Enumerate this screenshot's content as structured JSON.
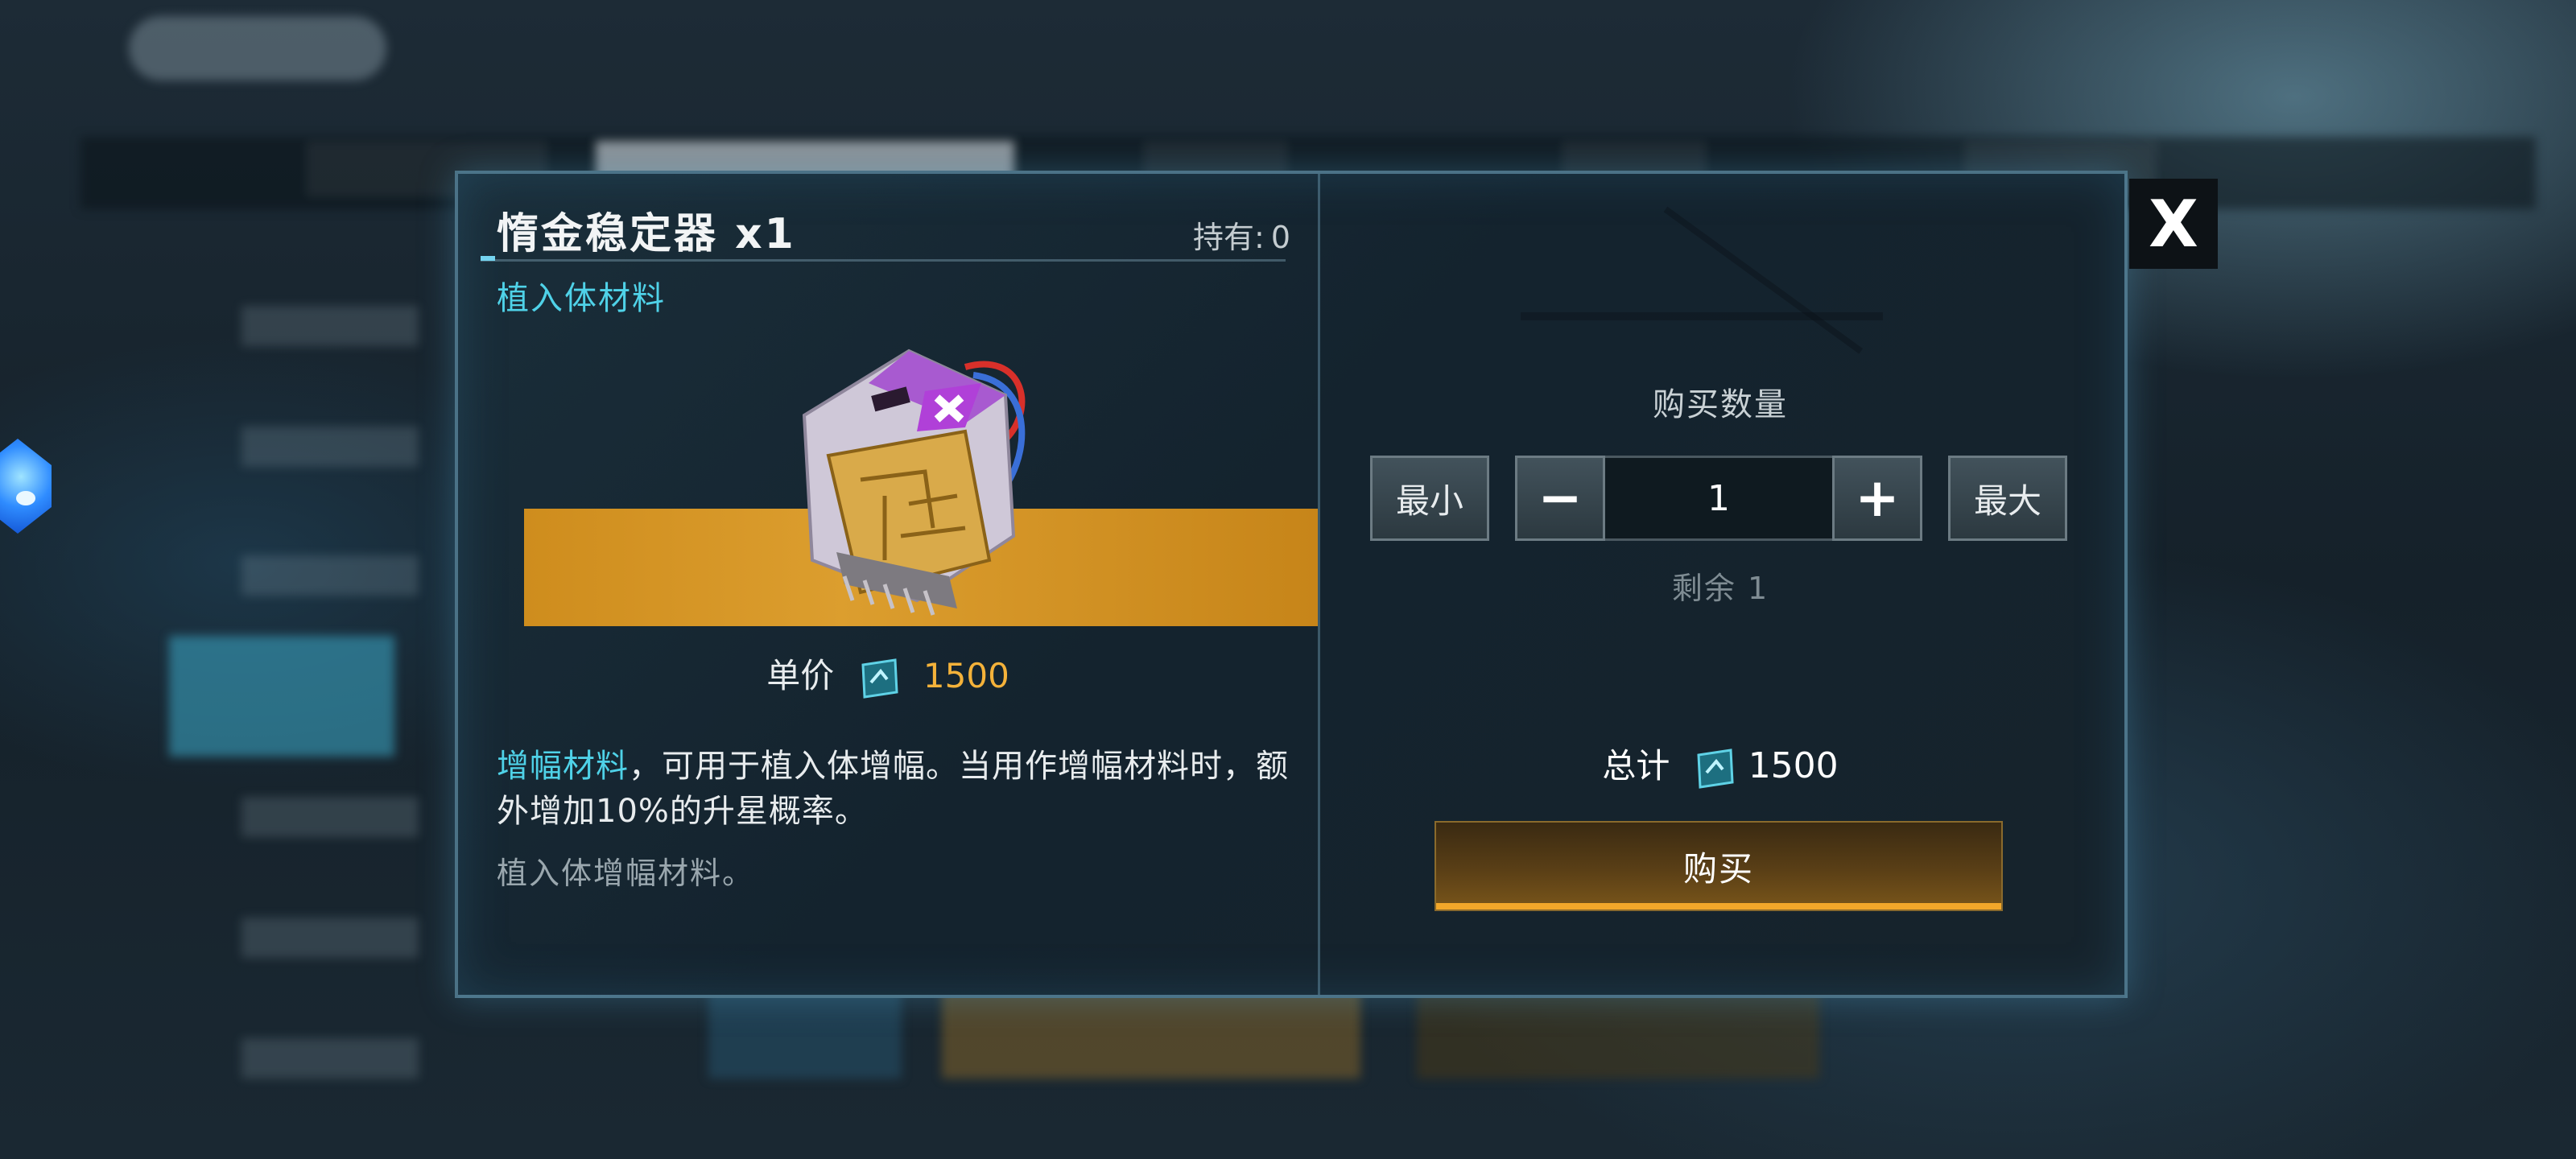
{
  "dialog": {
    "item_name": "惰金稳定器 x1",
    "holding_label": "持有:",
    "holding_value": "0",
    "category": "植入体材料",
    "unit_price_label": "单价",
    "unit_price_value": "1500",
    "description_highlight": "增幅材料",
    "description_rest": "，可用于植入体增幅。当用作增幅材料时，额外增加10%的升星概率。",
    "sub_description": "植入体增幅材料。"
  },
  "purchase": {
    "quantity_label": "购买数量",
    "min_label": "最小",
    "max_label": "最大",
    "quantity_value": "1",
    "remaining": "剩余 1",
    "total_label": "总计",
    "total_value": "1500",
    "buy_label": "购买"
  },
  "close_label": "X",
  "icons": {
    "currency": "currency-chip-icon",
    "minus": "minus-icon",
    "plus": "plus-icon",
    "close": "close-icon",
    "item": "stabilizer-chip-item-icon",
    "gem": "blue-gem-icon"
  },
  "colors": {
    "accent_cyan": "#4fd2e8",
    "price_gold": "#f4b23a",
    "item_band": "#e6a42e"
  }
}
